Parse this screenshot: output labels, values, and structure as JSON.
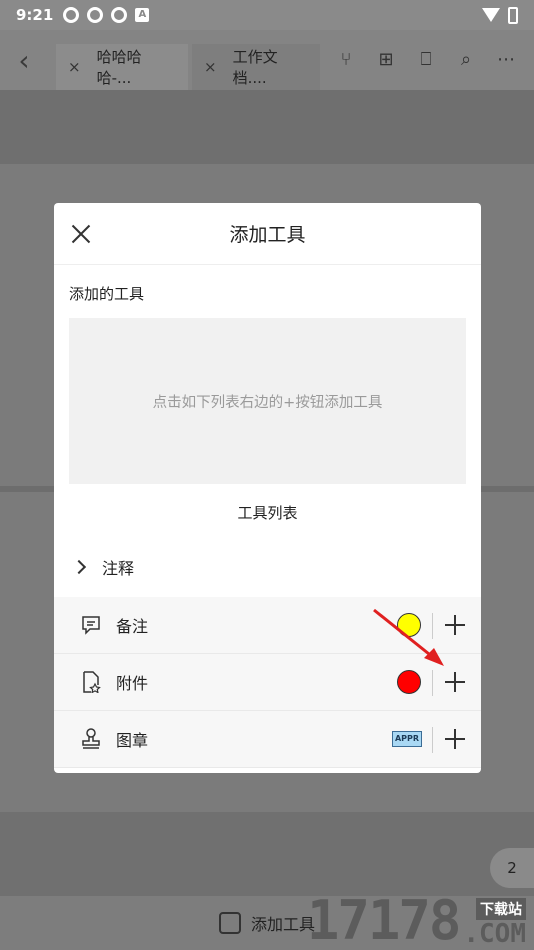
{
  "status_bar": {
    "time": "9:21",
    "app_badge": "A"
  },
  "toolbar": {
    "tabs": [
      {
        "label": "哈哈哈哈-..."
      },
      {
        "label": "工作文档...."
      }
    ],
    "icons": [
      "back-icon",
      "share-icon",
      "grid-icon",
      "bookmark-icon",
      "search-icon",
      "more-icon"
    ]
  },
  "dialog": {
    "title": "添加工具",
    "added_section_label": "添加的工具",
    "empty_hint": "点击如下列表右边的+按钮添加工具",
    "tool_list_title": "工具列表",
    "category": "注释",
    "tools": [
      {
        "label": "备注",
        "icon": "note-icon",
        "swatch_color": "#ffff00"
      },
      {
        "label": "附件",
        "icon": "attachment-icon",
        "swatch_color": "#ff0000"
      },
      {
        "label": "图章",
        "icon": "stamp-icon",
        "stamp_text": "APPR"
      }
    ]
  },
  "page_indicator": "2",
  "bottom_bar": {
    "label": "添加工具"
  },
  "watermark": {
    "number": "17178",
    "cn": "下载站",
    "com": ".COM"
  }
}
